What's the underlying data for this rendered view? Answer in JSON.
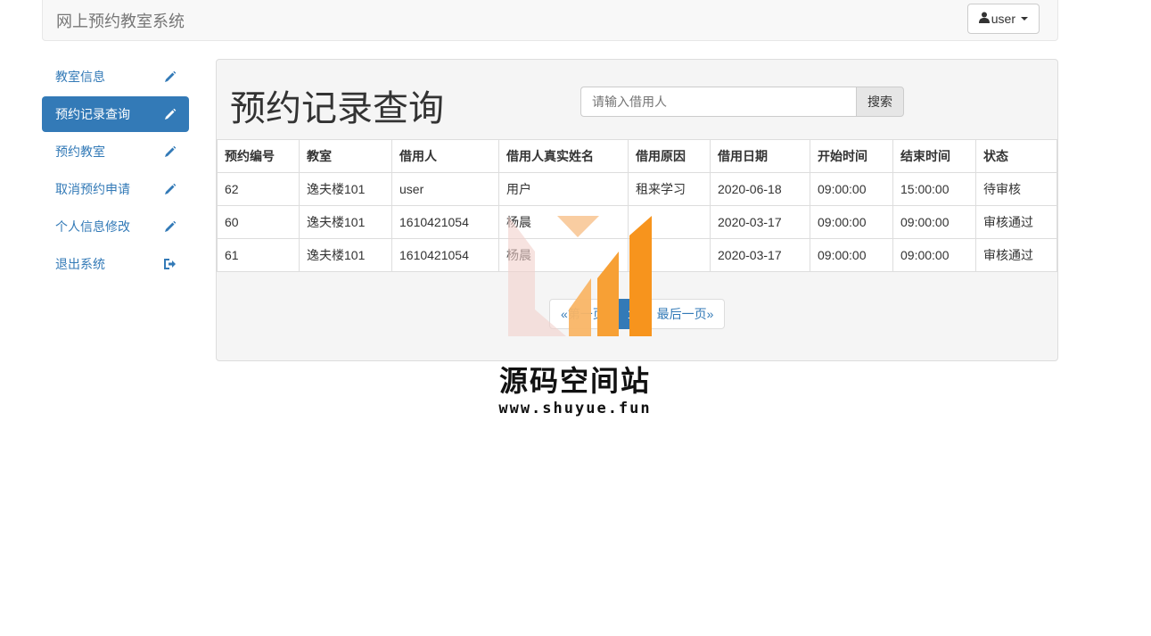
{
  "header": {
    "brand": "网上预约教室系统",
    "user_label": "user"
  },
  "sidebar": {
    "items": [
      {
        "label": "教室信息",
        "icon": "pencil-icon",
        "active": false
      },
      {
        "label": "预约记录查询",
        "icon": "pencil-icon",
        "active": true
      },
      {
        "label": "预约教室",
        "icon": "pencil-icon",
        "active": false
      },
      {
        "label": "取消预约申请",
        "icon": "pencil-icon",
        "active": false
      },
      {
        "label": "个人信息修改",
        "icon": "pencil-icon",
        "active": false
      },
      {
        "label": "退出系统",
        "icon": "logout-icon",
        "active": false
      }
    ]
  },
  "main": {
    "title": "预约记录查询",
    "search": {
      "placeholder": "请输入借用人",
      "value": "",
      "button_label": "搜索"
    },
    "table": {
      "headers": [
        "预约编号",
        "教室",
        "借用人",
        "借用人真实姓名",
        "借用原因",
        "借用日期",
        "开始时间",
        "结束时间",
        "状态"
      ],
      "rows": [
        [
          "62",
          "逸夫楼101",
          "user",
          "用户",
          "租来学习",
          "2020-06-18",
          "09:00:00",
          "15:00:00",
          "待审核"
        ],
        [
          "60",
          "逸夫楼101",
          "1610421054",
          "杨晨",
          "",
          "2020-03-17",
          "09:00:00",
          "09:00:00",
          "审核通过"
        ],
        [
          "61",
          "逸夫楼101",
          "1610421054",
          "杨晨",
          "",
          "2020-03-17",
          "09:00:00",
          "09:00:00",
          "审核通过"
        ]
      ]
    },
    "pagination": {
      "first_label": "«第一页",
      "current_page": "1",
      "last_label": "最后一页»"
    }
  },
  "watermark": {
    "title": "源码空间站",
    "url": "www.shuyue.fun"
  },
  "colors": {
    "primary": "#337ab7",
    "panel_bg": "#f5f5f5",
    "navbar_bg": "#f8f8f8",
    "watermark_orange": "#f7941d"
  }
}
